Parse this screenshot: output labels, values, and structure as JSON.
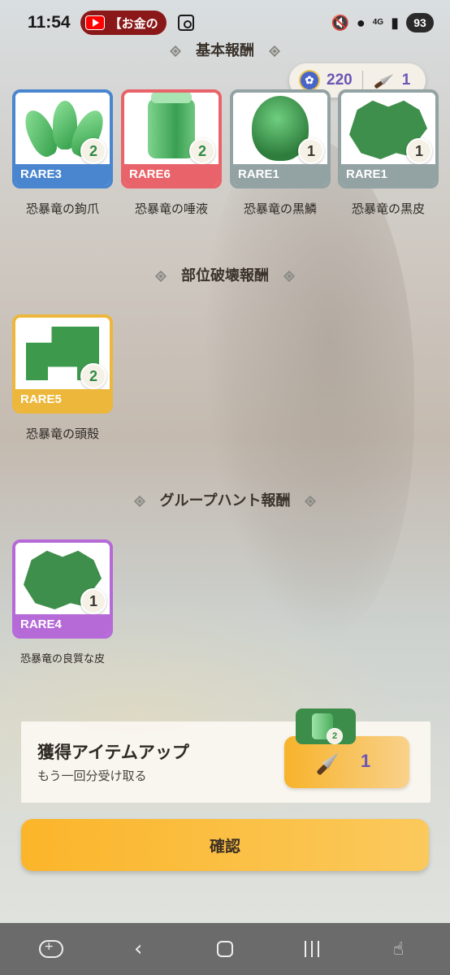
{
  "status_bar": {
    "time": "11:54",
    "notification_text": "【お金の",
    "network_label": "4G",
    "battery": "93"
  },
  "currency": {
    "points": "220",
    "knife_count": "1"
  },
  "sections": {
    "basic": {
      "title": "基本報酬",
      "items": [
        {
          "name": "恐暴竜の鉤爪",
          "rarity": "RARE3",
          "qty": "2",
          "qty_color": "#2f8a45"
        },
        {
          "name": "恐暴竜の唾液",
          "rarity": "RARE6",
          "qty": "2",
          "qty_color": "#2f8a45"
        },
        {
          "name": "恐暴竜の黒鱗",
          "rarity": "RARE1",
          "qty": "1",
          "qty_color": "#2e2a26"
        },
        {
          "name": "恐暴竜の黒皮",
          "rarity": "RARE1",
          "qty": "1",
          "qty_color": "#2e2a26"
        }
      ]
    },
    "break": {
      "title": "部位破壊報酬",
      "items": [
        {
          "name": "恐暴竜の頭殻",
          "rarity": "RARE5",
          "qty": "2",
          "qty_color": "#2f8a45"
        }
      ]
    },
    "group": {
      "title": "グループハント報酬",
      "items": [
        {
          "name": "恐暴竜の良質な皮",
          "rarity": "RARE4",
          "qty": "1",
          "qty_color": "#2e2a26"
        }
      ]
    }
  },
  "bonus": {
    "title": "獲得アイテムアップ",
    "subtitle": "もう一回分受け取る",
    "jar_qty": "2",
    "knife_count": "1"
  },
  "confirm": {
    "label": "確認"
  },
  "colors": {
    "rare1": "#93a2a3",
    "rare3": "#4a86cf",
    "rare4": "#b66ad8",
    "rare5": "#ecb73a",
    "rare6": "#e9646a",
    "accent_orange": "#f7b32b",
    "count_purple": "#6b55b5"
  },
  "icons": {
    "status_notification": "youtube-icon",
    "currency": [
      "paw-icon",
      "knife-icon"
    ],
    "nav": [
      "gamepad-icon",
      "back-icon",
      "home-icon",
      "recents-icon",
      "gesture-lock-icon"
    ]
  }
}
